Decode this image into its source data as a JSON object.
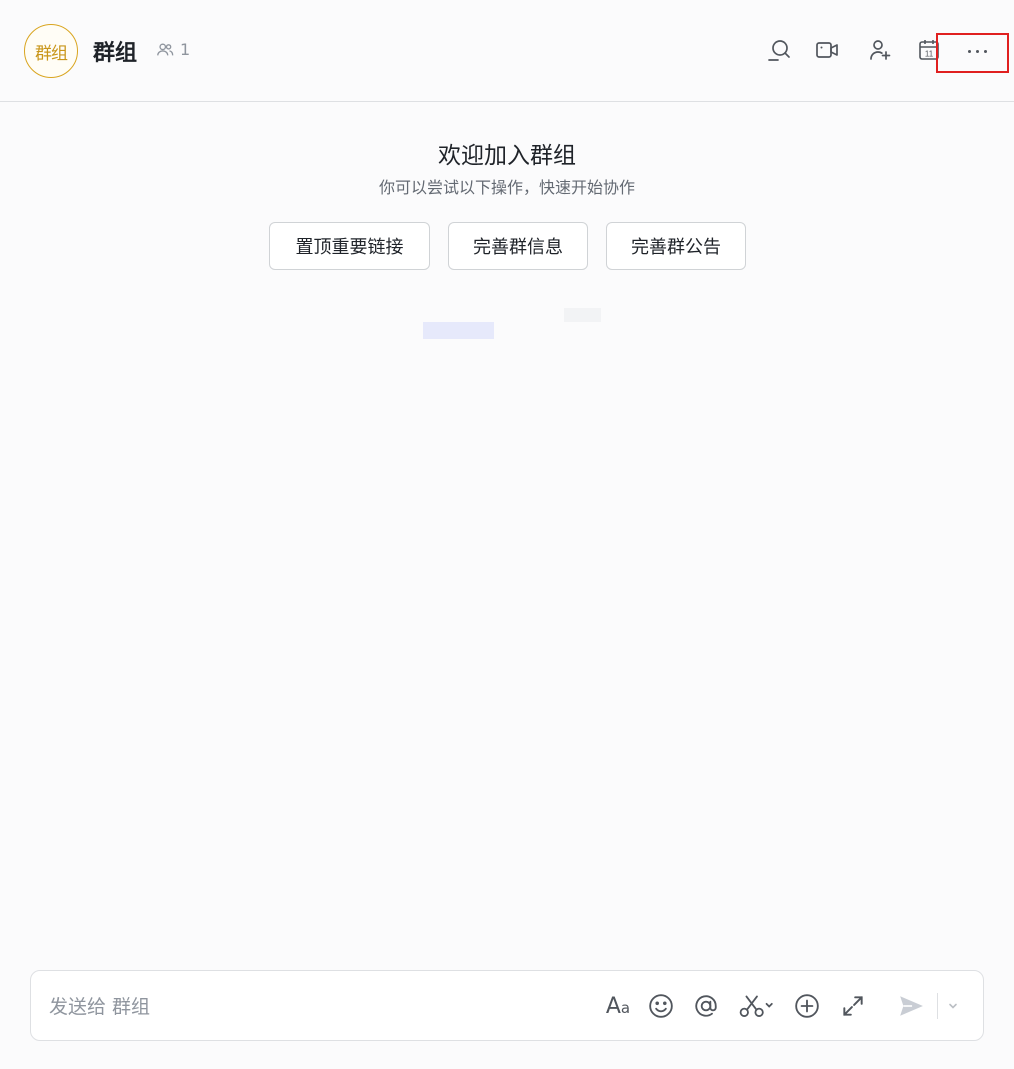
{
  "header": {
    "avatar_text": "群组",
    "title": "群组",
    "member_count": "1",
    "icons": [
      "search-icon",
      "video-call-icon",
      "add-member-icon",
      "calendar-icon",
      "more-icon"
    ],
    "calendar_day": "11"
  },
  "welcome": {
    "title": "欢迎加入群组",
    "subtitle": "你可以尝试以下操作，快速开始协作",
    "actions": [
      "置顶重要链接",
      "完善群信息",
      "完善群公告"
    ]
  },
  "composer": {
    "placeholder": "发送给 群组",
    "font_label": "A",
    "font_label_small": "a",
    "tools": [
      "font-format-icon",
      "emoji-icon",
      "mention-icon",
      "scissors-icon",
      "add-icon",
      "expand-icon",
      "send-icon",
      "send-options-chevron-icon"
    ]
  },
  "colors": {
    "accent_avatar": "#d9a520",
    "highlight_box": "#e02020",
    "send_disabled": "#c9cdd4"
  }
}
